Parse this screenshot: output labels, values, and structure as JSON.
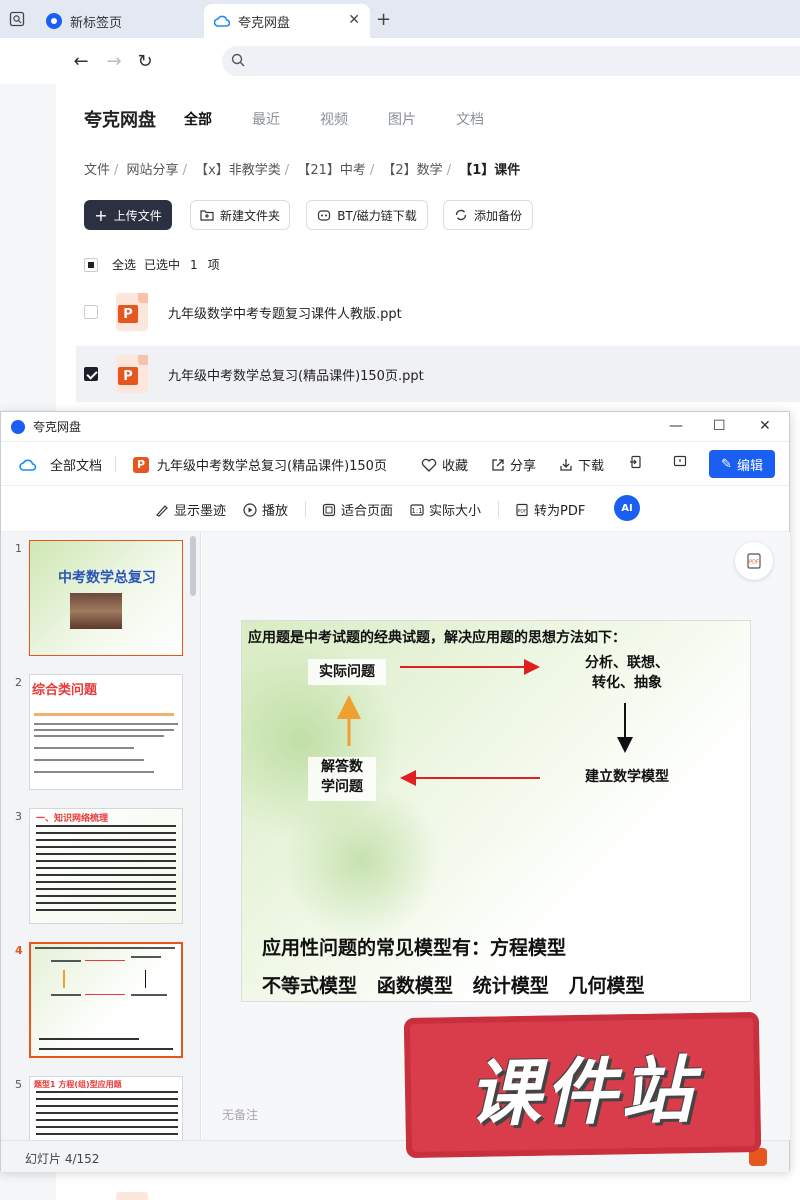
{
  "browser": {
    "tabs": [
      {
        "label": "新标签页",
        "active": false
      },
      {
        "label": "夸克网盘",
        "active": true
      }
    ],
    "address": ""
  },
  "drive": {
    "brand": "夸克网盘",
    "nav": [
      "全部",
      "最近",
      "视频",
      "图片",
      "文档"
    ],
    "breadcrumbs": [
      "文件",
      "网站分享",
      "【x】非教学类",
      "【21】中考",
      "【2】数学",
      "【1】课件"
    ],
    "actions": {
      "upload": "上传文件",
      "new_folder": "新建文件夹",
      "bt": "BT/磁力链下载",
      "backup": "添加备份"
    },
    "select_all": "全选",
    "selected_prefix": "已选中",
    "selected_count": "1",
    "selected_suffix": "项",
    "files": [
      {
        "name": "九年级数学中考专题复习课件人教版.ppt",
        "selected": false
      },
      {
        "name": "九年级中考数学总复习(精品课件)150页.ppt",
        "selected": true
      }
    ]
  },
  "viewer": {
    "window_title": "夸克网盘",
    "all_docs": "全部文档",
    "doc_title": "九年级中考数学总复习(精品课件)150页",
    "favorite": "收藏",
    "share": "分享",
    "download": "下载",
    "edit": "编辑",
    "tools": {
      "ink": "显示墨迹",
      "play": "播放",
      "fit": "适合页面",
      "actual": "实际大小",
      "to_pdf": "转为PDF",
      "ai": "AI"
    },
    "thumbs": [
      {
        "num": "1",
        "title": "中考数学总复习"
      },
      {
        "num": "2",
        "title": "综合类问题"
      },
      {
        "num": "3",
        "title": "一、知识网络梳理"
      },
      {
        "num": "4",
        "title": ""
      },
      {
        "num": "5",
        "title": "题型1 方程(组)型应用题"
      }
    ],
    "slide": {
      "heading": "应用题是中考试题的经典试题，解决应用题的思想方法如下：",
      "box1": "实际问题",
      "box2": "分析、联想、\n转化、抽象",
      "box3": "建立数学模型",
      "box4": "解答数\n学问题",
      "line1": "应用性问题的常见模型有：方程模型",
      "line2": "不等式模型   函数模型   统计模型   几何模型"
    },
    "notes_placeholder": "无备注",
    "slide_counter": "幻灯片 4/152"
  },
  "watermark": "课件站"
}
